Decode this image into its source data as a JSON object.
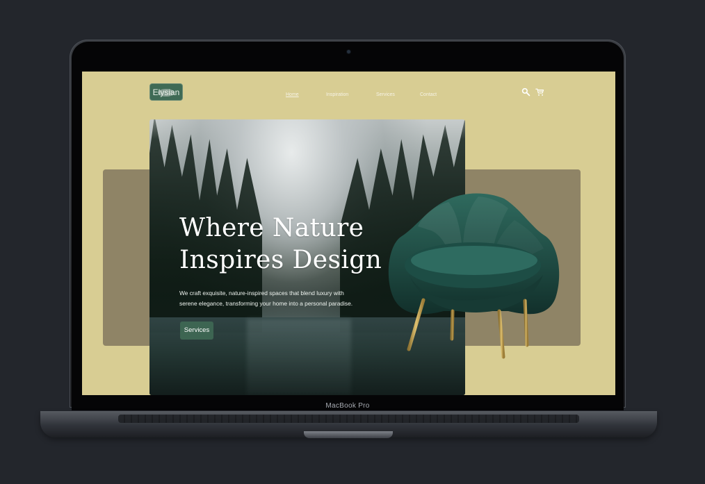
{
  "device": {
    "label": "MacBook Pro"
  },
  "site": {
    "logo_text": "Elysian",
    "nav": [
      "Home",
      "Inspiration",
      "Services",
      "Contact"
    ],
    "icons": [
      "search-icon",
      "cart-icon"
    ],
    "hero": {
      "title": "Where Nature Inspires Design",
      "description": "We craft exquisite, nature-inspired spaces that blend luxury with serene elegance, transforming your home into a personal paradise.",
      "button_label": "Services"
    }
  },
  "colors": {
    "background": "#23262c",
    "site_background": "#d8cd93",
    "panel": "#8f8466",
    "accent": "#3d6552",
    "chair": "#1f4b43",
    "chair_leg": "#c8a75d"
  }
}
